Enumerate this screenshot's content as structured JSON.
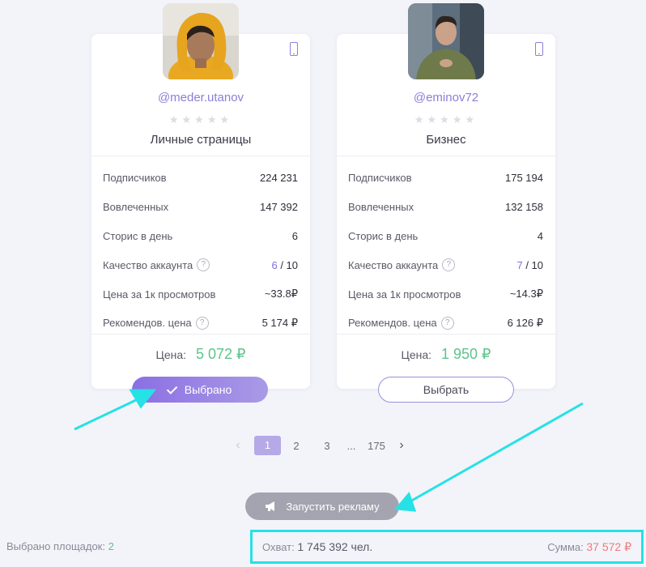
{
  "cards": [
    {
      "username": "@meder.utanov",
      "stars": "★★★★★",
      "category": "Личные страницы",
      "stats": {
        "subscribers_label": "Подписчиков",
        "subscribers": "224 231",
        "engaged_label": "Вовлеченных",
        "engaged": "147 392",
        "stories_label": "Сторис в день",
        "stories": "6",
        "quality_label": "Качество аккаунта",
        "quality_score": "6",
        "quality_max": "/ 10",
        "cpm_label": "Цена за 1к просмотров",
        "cpm": "~33.8₽",
        "recommended_label": "Рекомендов. цена",
        "recommended": "5 174 ₽"
      },
      "price_label": "Цена:",
      "price": "5 072 ₽",
      "button_label": "Выбрано",
      "selected": true
    },
    {
      "username": "@eminov72",
      "stars": "★★★★★",
      "category": "Бизнес",
      "stats": {
        "subscribers_label": "Подписчиков",
        "subscribers": "175 194",
        "engaged_label": "Вовлеченных",
        "engaged": "132 158",
        "stories_label": "Сторис в день",
        "stories": "4",
        "quality_label": "Качество аккаунта",
        "quality_score": "7",
        "quality_max": "/ 10",
        "cpm_label": "Цена за 1к просмотров",
        "cpm": "~14.3₽",
        "recommended_label": "Рекомендов. цена",
        "recommended": "6 126 ₽"
      },
      "price_label": "Цена:",
      "price": "1 950 ₽",
      "button_label": "Выбрать",
      "selected": false
    }
  ],
  "help_glyph": "?",
  "pagination": {
    "prev": "‹",
    "pages": [
      "1",
      "2",
      "3"
    ],
    "ellipsis": "...",
    "last": "175",
    "next": "›",
    "current": "1"
  },
  "launch_button": "Запустить рекламу",
  "footer": {
    "selected_label": "Выбрано площадок:",
    "selected_count": "2",
    "reach_label": "Охват:",
    "reach_value": "1 745 392 чел.",
    "sum_label": "Сумма:",
    "sum_value": "37 572 ₽"
  },
  "colors": {
    "accent": "#8b6fe4",
    "price_green": "#5cc48b",
    "sum_red": "#ef7a7a",
    "annotation_cyan": "#26e1e6"
  }
}
